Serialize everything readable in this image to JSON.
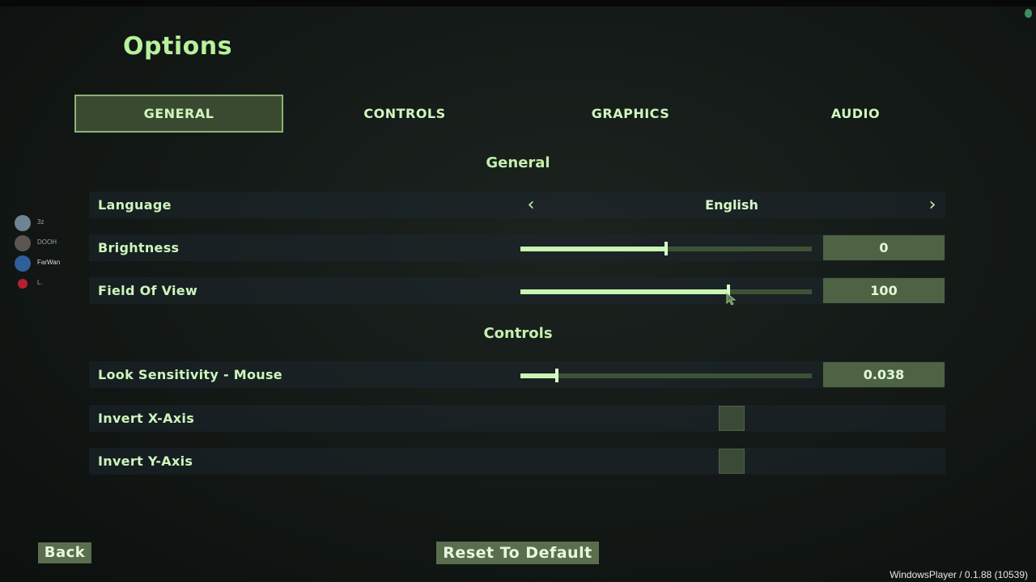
{
  "title": "Options",
  "tabs": [
    {
      "label": "GENERAL",
      "active": true
    },
    {
      "label": "CONTROLS",
      "active": false
    },
    {
      "label": "GRAPHICS",
      "active": false
    },
    {
      "label": "AUDIO",
      "active": false
    }
  ],
  "sections": {
    "general": "General",
    "controls": "Controls"
  },
  "settings": {
    "language": {
      "label": "Language",
      "value": "English"
    },
    "brightness": {
      "label": "Brightness",
      "value": "0",
      "level": 0.5
    },
    "fov": {
      "label": "Field Of View",
      "value": "100",
      "level": 0.715
    },
    "look_sensitivity": {
      "label": "Look Sensitivity - Mouse",
      "value": "0.038",
      "level": 0.126
    },
    "invert_x": {
      "label": "Invert X-Axis",
      "checked": false
    },
    "invert_y": {
      "label": "Invert Y-Axis",
      "checked": false
    }
  },
  "buttons": {
    "back": "Back",
    "reset": "Reset To Default"
  },
  "footer": "WindowsPlayer / 0.1.88 (10539)",
  "players": [
    {
      "name": "3z",
      "color": "#6e8494"
    },
    {
      "name": "DOOH",
      "color": "#5a5550"
    },
    {
      "name": "FarWan",
      "color": "#2f5f9a"
    },
    {
      "name": "L.",
      "color": "#b52030"
    }
  ],
  "colors": {
    "accent": "#b6f29c",
    "active_tab_bg": "#3a4a30",
    "value_box_bg": "#4d6343"
  }
}
